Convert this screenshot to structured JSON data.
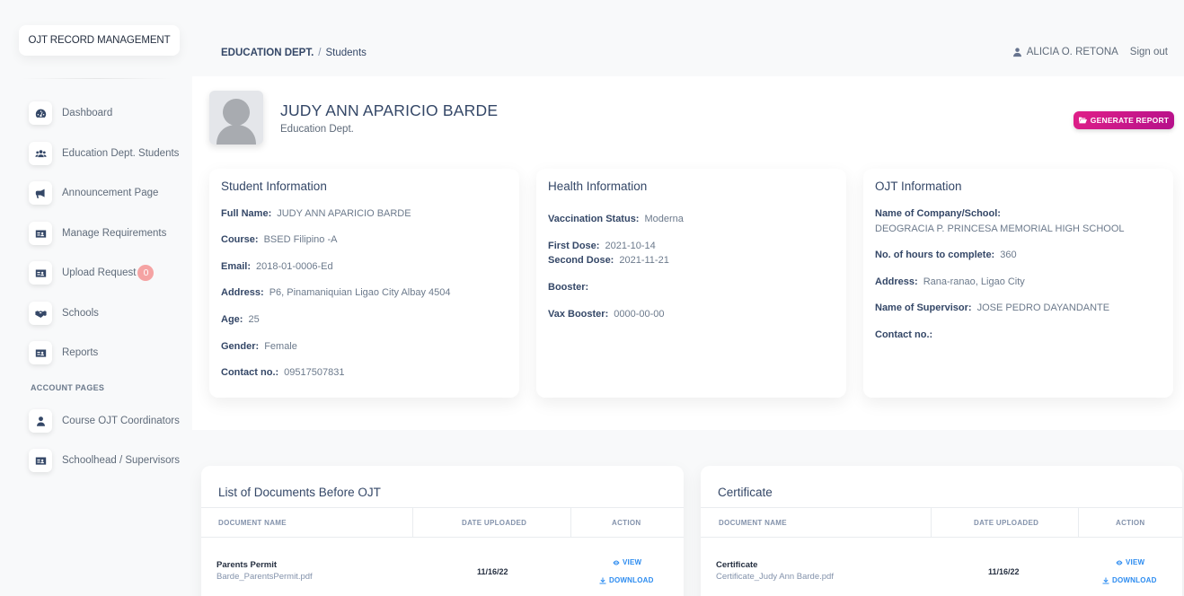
{
  "brand": "OJT RECORD MANAGEMENT",
  "nav": [
    {
      "label": "Dashboard",
      "icon": "dashboard-icon"
    },
    {
      "label": "Education Dept. Students",
      "icon": "users-icon"
    },
    {
      "label": "Announcement Page",
      "icon": "megaphone-icon"
    },
    {
      "label": "Manage Requirements",
      "icon": "id-card-icon"
    },
    {
      "label": "Upload Request",
      "icon": "id-card-icon",
      "badge": "0"
    },
    {
      "label": "Schools",
      "icon": "handshake-icon"
    },
    {
      "label": "Reports",
      "icon": "id-card-icon"
    }
  ],
  "account_section": "ACCOUNT PAGES",
  "account_nav": [
    {
      "label": "Course OJT Coordinators",
      "icon": "user-icon"
    },
    {
      "label": "Schoolhead / Supervisors",
      "icon": "id-card-icon"
    }
  ],
  "breadcrumb": {
    "root": "EDUCATION DEPT.",
    "sep": "/",
    "current": "Students"
  },
  "user": {
    "name": "ALICIA O. RETONA",
    "signout": "Sign out"
  },
  "profile": {
    "name": "JUDY ANN APARICIO BARDE",
    "dept": "Education Dept."
  },
  "generate_report": "GENERATE REPORT",
  "student_info": {
    "title": "Student Information",
    "fields": [
      {
        "k": "Full Name:",
        "v": "JUDY ANN APARICIO BARDE"
      },
      {
        "k": "Course:",
        "v": "BSED Filipino -A"
      },
      {
        "k": "Email:",
        "v": "2018-01-0006-Ed"
      },
      {
        "k": "Address:",
        "v": "P6, Pinamaniquian Ligao City Albay 4504"
      },
      {
        "k": "Age:",
        "v": "25"
      },
      {
        "k": "Gender:",
        "v": "Female"
      },
      {
        "k": "Contact no.:",
        "v": "09517507831"
      }
    ]
  },
  "health_info": {
    "title": "Health Information",
    "fields": [
      {
        "k": "Vaccination Status:",
        "v": "Moderna"
      },
      {
        "k": "First Dose:",
        "v": "2021-10-14"
      },
      {
        "k": "Second Dose:",
        "v": "2021-11-21"
      },
      {
        "k": "Booster:",
        "v": ""
      },
      {
        "k": "Vax Booster:",
        "v": "0000-00-00"
      }
    ]
  },
  "ojt_info": {
    "title": "OJT Information",
    "company_label": "Name of Company/School:",
    "company_value": "DEOGRACIA P. PRINCESA MEMORIAL HIGH SCHOOL",
    "fields": [
      {
        "k": "No. of hours to complete:",
        "v": "360"
      },
      {
        "k": "Address:",
        "v": "Rana-ranao, Ligao City"
      },
      {
        "k": "Name of Supervisor:",
        "v": "JOSE PEDRO DAYANDANTE"
      },
      {
        "k": "Contact no.:",
        "v": ""
      }
    ]
  },
  "docs_table": {
    "title": "List of Documents Before OJT",
    "headers": [
      "DOCUMENT NAME",
      "DATE UPLOADED",
      "ACTION"
    ],
    "row": {
      "name": "Parents Permit",
      "file": "Barde_ParentsPermit.pdf",
      "date": "11/16/22"
    }
  },
  "cert_table": {
    "title": "Certificate",
    "headers": [
      "DOCUMENT NAME",
      "DATE UPLOADED",
      "ACTION"
    ],
    "row": {
      "name": "Certificate",
      "file": "Certificate_Judy Ann Barde.pdf",
      "date": "11/16/22"
    }
  },
  "actions": {
    "view": "VIEW",
    "download": "DOWNLOAD"
  },
  "colors": {
    "accent": "#cb0c9f",
    "link": "#2d8cf0",
    "badge": "#f5a3a3"
  }
}
